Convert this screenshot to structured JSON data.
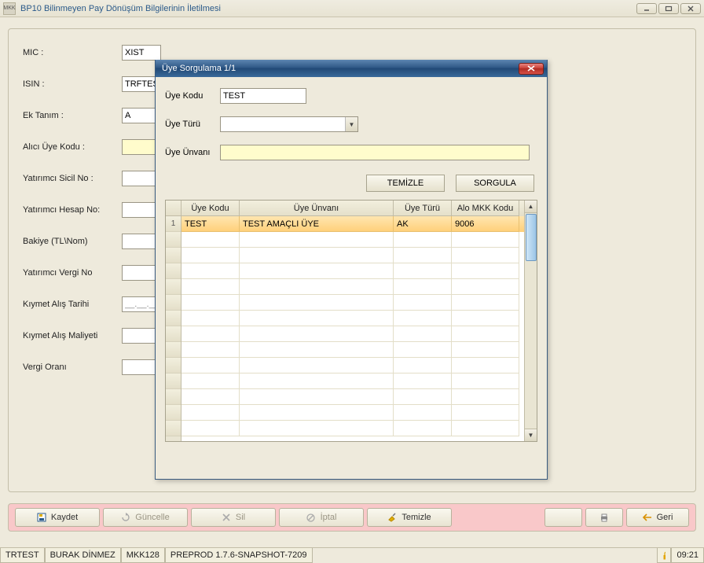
{
  "window": {
    "title": "BP10 Bilinmeyen Pay Dönüşüm Bilgilerinin İletilmesi",
    "icon_text": "MKK"
  },
  "form": {
    "mic_label": "MIC :",
    "mic_value": "XIST",
    "isin_label": "ISIN :",
    "isin_value": "TRFTEST",
    "ek_tanim_label": "Ek Tanım :",
    "ek_tanim_value": "A",
    "alici_uye_kodu_label": "Alıcı Üye Kodu :",
    "alici_uye_kodu_value": "",
    "yatirimci_sicil_no_label": "Yatırımcı Sicil No :",
    "yatirimci_sicil_no_value": "",
    "yatirimci_hesap_no_label": "Yatırımcı Hesap No:",
    "yatirimci_hesap_no_value": "",
    "bakiye_label": "Bakiye (TL\\Nom)",
    "bakiye_value": "",
    "yatirimci_vergi_no_label": "Yatırımcı Vergi No",
    "yatirimci_vergi_no_value": "",
    "kiymet_alis_tarihi_label": "Kıymet Alış Tarihi",
    "kiymet_alis_tarihi_value": "__.__.____",
    "kiymet_alis_maliyeti_label": "Kıymet Alış Maliyeti",
    "kiymet_alis_maliyeti_value": "",
    "vergi_orani_label": "Vergi Oranı",
    "vergi_orani_value": ""
  },
  "buttons": {
    "kaydet": "Kaydet",
    "guncelle": "Güncelle",
    "sil": "Sil",
    "iptal": "İptal",
    "temizle": "Temizle",
    "geri": "Geri"
  },
  "status": {
    "cell1": "TRTEST",
    "cell2": "BURAK DİNMEZ",
    "cell3": "MKK128",
    "cell4": "PREPROD 1.7.6-SNAPSHOT-7209",
    "clock": "09:21"
  },
  "modal": {
    "title": "Üye Sorgulama  1/1",
    "uye_kodu_label": "Üye Kodu",
    "uye_kodu_value": "TEST",
    "uye_turu_label": "Üye Türü",
    "uye_turu_value": "",
    "uye_unvani_label": "Üye Ünvanı",
    "uye_unvani_value": "",
    "temizle": "TEMİZLE",
    "sorgula": "SORGULA",
    "grid": {
      "headers": {
        "c1": "Üye Kodu",
        "c2": "Üye Ünvanı",
        "c3": "Üye Türü",
        "c4": "Alo MKK Kodu"
      },
      "row1": {
        "num": "1",
        "c1": "TEST",
        "c2": "TEST AMAÇLI ÜYE",
        "c3": "AK",
        "c4": "9006"
      }
    }
  }
}
